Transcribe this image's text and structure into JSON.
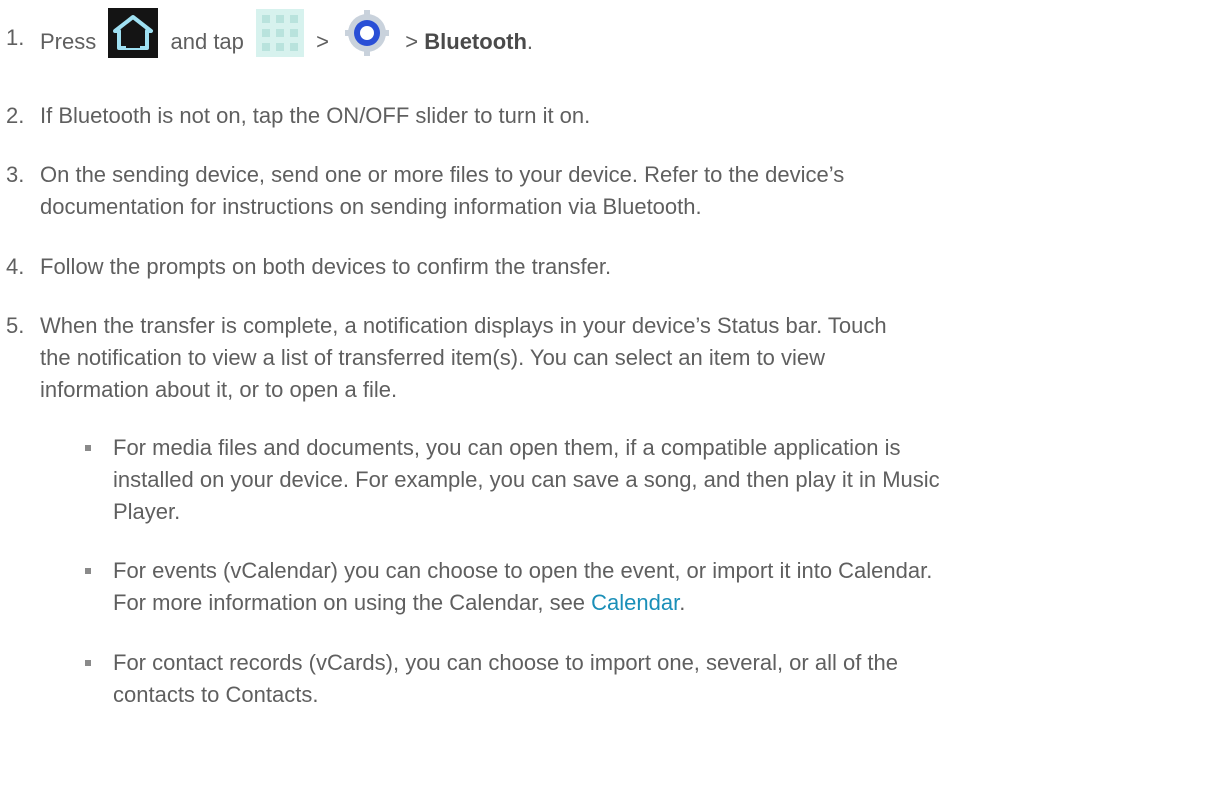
{
  "steps": [
    {
      "number": "1.",
      "parts": {
        "press": "Press",
        "and_tap": "and tap",
        "sep1": ">",
        "sep2": ">",
        "bluetooth": "Bluetooth",
        "period": "."
      },
      "icons": [
        "home-icon",
        "apps-icon",
        "settings-icon"
      ]
    },
    {
      "number": "2.",
      "text": "If Bluetooth is not on, tap the ON/OFF slider to turn it on."
    },
    {
      "number": "3.",
      "lines": [
        "On the sending device, send one or more files to your device. Refer to the device’s",
        "documentation for instructions on sending information via Bluetooth."
      ]
    },
    {
      "number": "4.",
      "text": "Follow the prompts on both devices to confirm the transfer."
    },
    {
      "number": "5.",
      "lines": [
        "When the transfer is complete, a notification displays in your device’s Status bar. Touch",
        "the notification to view a list of transferred item(s). You can select an item to view",
        "information about it, or to open a file."
      ]
    }
  ],
  "bullets": [
    {
      "lines": [
        "For media files and documents, you can open them, if a compatible application is",
        "installed on your device. For example, you can save a song, and then play it in Music",
        "Player."
      ]
    },
    {
      "line1": "For events (vCalendar) you can choose to open the event, or import it into Calendar.",
      "line2_prefix": "For more information on using the Calendar, see ",
      "link": "Calendar",
      "line2_suffix": "."
    },
    {
      "lines": [
        "For contact records (vCards), you can choose to import one, several, or all of the",
        "contacts to Contacts."
      ]
    }
  ],
  "colors": {
    "text": "#5f5f5f",
    "link": "#1a8fb8",
    "bullet": "#8a8a8a"
  }
}
